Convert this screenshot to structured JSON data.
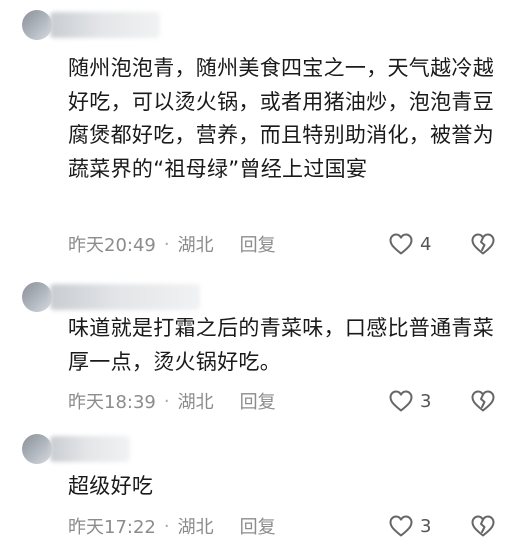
{
  "comments": [
    {
      "text": "随州泡泡青，随州美食四宝之一，天气越冷越好吃，可以烫火锅，或者用猪油炒，泡泡青豆腐煲都好吃，营养，而且特别助消化，被誉为蔬菜界的“祖母绿”曾经上过国宴",
      "time": "昨天20:49",
      "separator": "·",
      "location": "湖北",
      "reply_label": "回复",
      "likes": "4",
      "like_icon": "heart-outline-icon",
      "dislike_icon": "broken-heart-icon"
    },
    {
      "text": "味道就是打霜之后的青菜味，口感比普通青菜厚一点，烫火锅好吃。",
      "time": "昨天18:39",
      "separator": "·",
      "location": "湖北",
      "reply_label": "回复",
      "likes": "3",
      "like_icon": "heart-outline-icon",
      "dislike_icon": "broken-heart-icon"
    },
    {
      "text": "超级好吃",
      "time": "昨天17:22",
      "separator": "·",
      "location": "湖北",
      "reply_label": "回复",
      "likes": "3",
      "like_icon": "heart-outline-icon",
      "dislike_icon": "broken-heart-icon"
    }
  ],
  "colors": {
    "text": "#1a1a1a",
    "meta": "#8c8c8c",
    "background": "#ffffff"
  }
}
